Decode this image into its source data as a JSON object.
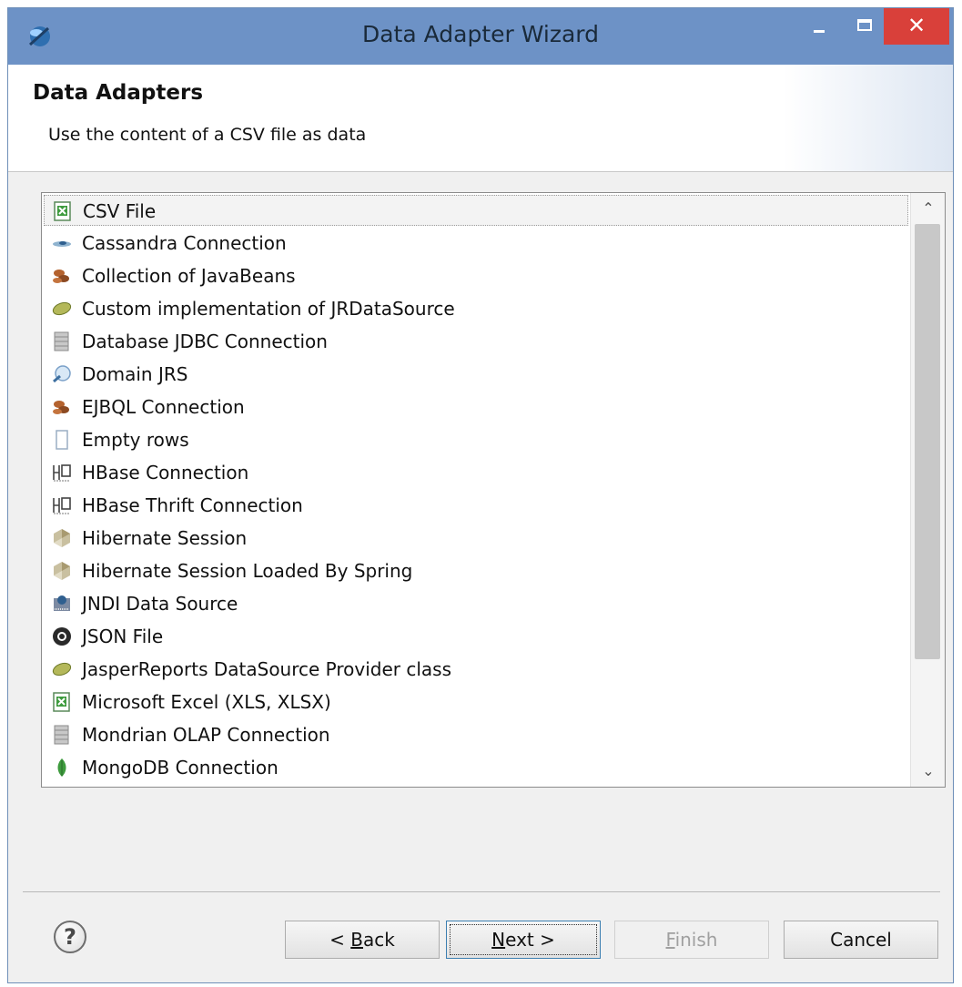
{
  "window": {
    "title": "Data Adapter Wizard",
    "close_glyph": "✕",
    "close_color": "#d9403a",
    "titlebar_color": "#6d92c6"
  },
  "header": {
    "title": "Data Adapters",
    "description": "Use the content of a CSV file as data"
  },
  "adapters": [
    {
      "label": "CSV File",
      "icon": "spreadsheet-icon",
      "selected": true
    },
    {
      "label": "Cassandra Connection",
      "icon": "cassandra-eye-icon"
    },
    {
      "label": "Collection of JavaBeans",
      "icon": "beans-icon"
    },
    {
      "label": "Custom implementation of JRDataSource",
      "icon": "bean-icon"
    },
    {
      "label": "Database JDBC Connection",
      "icon": "database-icon"
    },
    {
      "label": "Domain JRS",
      "icon": "domain-icon"
    },
    {
      "label": "EJBQL Connection",
      "icon": "beans-icon"
    },
    {
      "label": "Empty rows",
      "icon": "empty-rows-icon"
    },
    {
      "label": "HBase Connection",
      "icon": "hbase-icon"
    },
    {
      "label": "HBase Thrift Connection",
      "icon": "hbase-icon"
    },
    {
      "label": "Hibernate Session",
      "icon": "hibernate-icon"
    },
    {
      "label": "Hibernate Session Loaded By Spring",
      "icon": "hibernate-icon"
    },
    {
      "label": "JNDI Data Source",
      "icon": "jndi-icon"
    },
    {
      "label": "JSON File",
      "icon": "json-icon"
    },
    {
      "label": "JasperReports DataSource Provider class",
      "icon": "bean-icon"
    },
    {
      "label": "Microsoft Excel (XLS, XLSX)",
      "icon": "spreadsheet-icon"
    },
    {
      "label": "Mondrian OLAP Connection",
      "icon": "database-icon"
    },
    {
      "label": "MongoDB Connection",
      "icon": "mongodb-leaf-icon"
    }
  ],
  "scrollbar": {
    "up": "⌃",
    "down": "⌄"
  },
  "buttons": {
    "help": "?",
    "back_prefix": "< ",
    "back_mnemonic": "B",
    "back_rest": "ack",
    "next_mnemonic": "N",
    "next_rest": "ext >",
    "finish_mnemonic": "F",
    "finish_rest": "inish",
    "cancel": "Cancel"
  }
}
